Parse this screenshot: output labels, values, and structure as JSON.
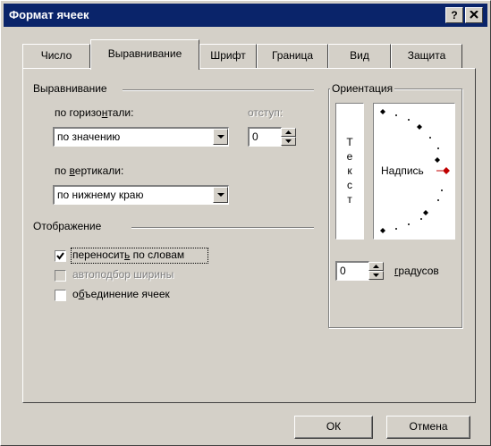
{
  "window": {
    "title": "Формат ячеек",
    "help_label": "?",
    "close_label": "✕"
  },
  "tabs": [
    {
      "label": "Число"
    },
    {
      "label": "Выравнивание",
      "active": true
    },
    {
      "label": "Шрифт"
    },
    {
      "label": "Граница"
    },
    {
      "label": "Вид"
    },
    {
      "label": "Защита"
    }
  ],
  "alignment": {
    "group_label": "Выравнивание",
    "horizontal_label_pre": "по горизо",
    "horizontal_label_u": "н",
    "horizontal_label_post": "тали:",
    "horizontal_value": "по значению",
    "indent_label": "отступ:",
    "indent_value": "0",
    "vertical_label_pre": "по ",
    "vertical_label_u": "в",
    "vertical_label_post": "ертикали:",
    "vertical_value": "по нижнему краю"
  },
  "display": {
    "group_label": "Отображение",
    "wrap_pre": "переносит",
    "wrap_u": "ь",
    "wrap_post": " по словам",
    "wrap_checked": true,
    "shrink_label": "автоподбор ширины",
    "shrink_checked": false,
    "merge_pre": "о",
    "merge_u": "б",
    "merge_post": "ъединение ячеек",
    "merge_checked": false
  },
  "orientation": {
    "group_label": "Ориентация",
    "vertical_text": [
      "Т",
      "е",
      "к",
      "с",
      "т"
    ],
    "sample_text": "Надпись",
    "degrees_value": "0",
    "degrees_label_u": "г",
    "degrees_label_post": "радусов",
    "marker_color": "#c00000"
  },
  "buttons": {
    "ok_label": "ОК",
    "cancel_label": "Отмена"
  },
  "colors": {
    "titlebar": "#0a246a",
    "face": "#d4d0c8"
  }
}
